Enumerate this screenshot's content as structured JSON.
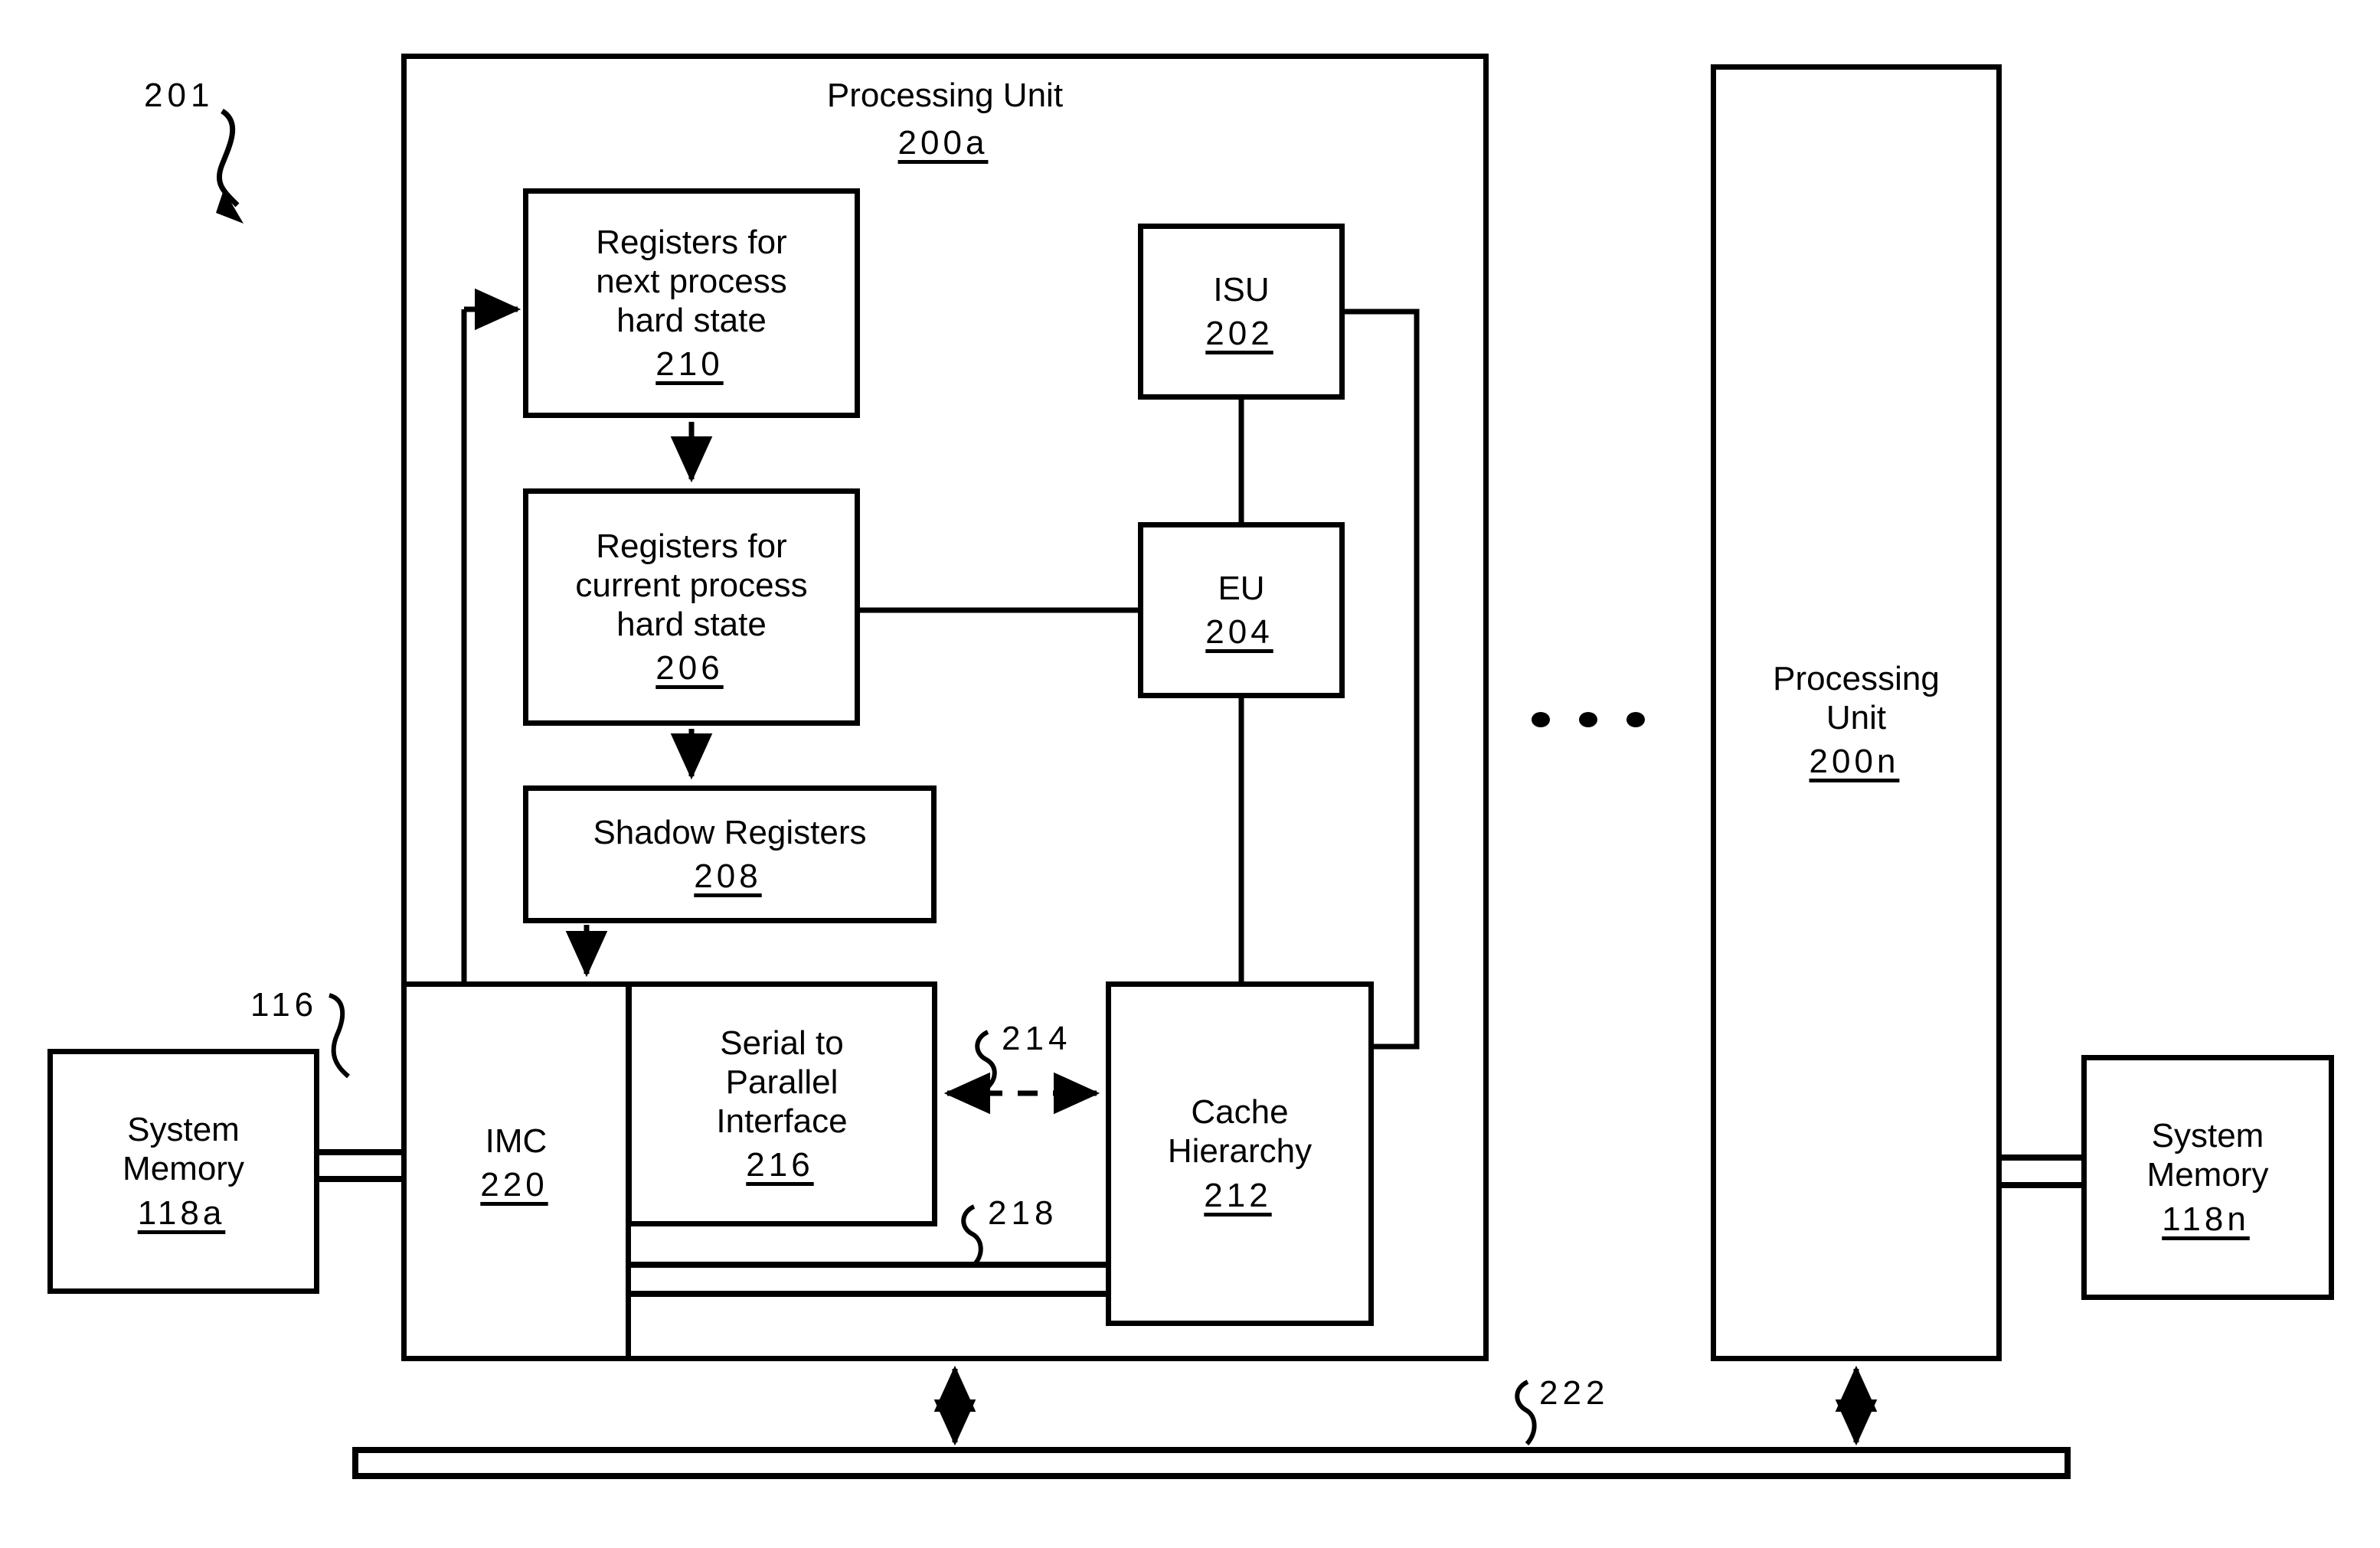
{
  "figure": {
    "top_ref": "201",
    "bus_ref": "222",
    "memory_bus_ref": "116",
    "cache_link_ref": "214",
    "imc_bus_ref": "218"
  },
  "processing_unit_a": {
    "title": "Processing Unit",
    "ref": "200a"
  },
  "processing_unit_n": {
    "title_line1": "Processing",
    "title_line2": "Unit",
    "ref": "200n"
  },
  "blocks": {
    "next_regs": {
      "line1": "Registers for",
      "line2": "next process",
      "line3": "hard state",
      "ref": "210"
    },
    "current_regs": {
      "line1": "Registers for",
      "line2": "current process",
      "line3": "hard state",
      "ref": "206"
    },
    "shadow_regs": {
      "line1": "Shadow Registers",
      "ref": "208"
    },
    "isu": {
      "line1": "ISU",
      "ref": "202"
    },
    "eu": {
      "line1": "EU",
      "ref": "204"
    },
    "cache": {
      "line1": "Cache",
      "line2": "Hierarchy",
      "ref": "212"
    },
    "imc": {
      "line1": "IMC",
      "ref": "220"
    },
    "serial_parallel": {
      "line1": "Serial to",
      "line2": "Parallel",
      "line3": "Interface",
      "ref": "216"
    },
    "system_memory_a": {
      "line1": "System",
      "line2": "Memory",
      "ref": "118a"
    },
    "system_memory_n": {
      "line1": "System",
      "line2": "Memory",
      "ref": "118n"
    }
  },
  "ellipsis": {
    "glyph": "dots"
  },
  "colors": {
    "ink": "#000000",
    "paper": "#ffffff"
  }
}
